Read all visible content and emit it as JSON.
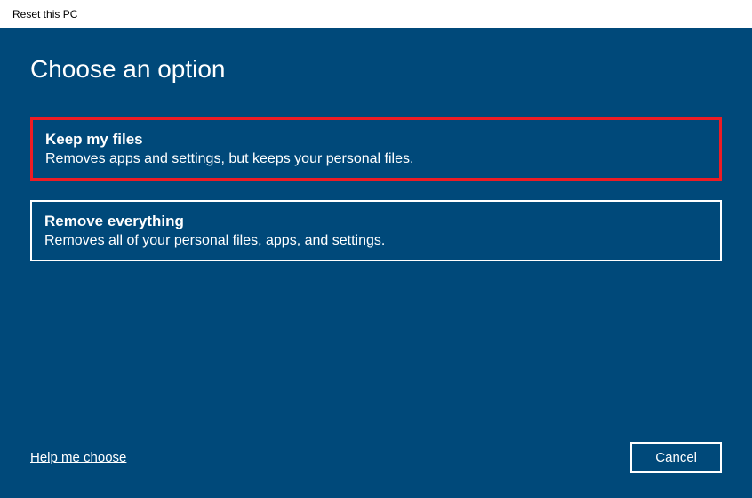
{
  "window": {
    "title": "Reset this PC"
  },
  "heading": "Choose an option",
  "options": [
    {
      "title": "Keep my files",
      "description": "Removes apps and settings, but keeps your personal files."
    },
    {
      "title": "Remove everything",
      "description": "Removes all of your personal files, apps, and settings."
    }
  ],
  "footer": {
    "help_link": "Help me choose",
    "cancel_label": "Cancel"
  }
}
